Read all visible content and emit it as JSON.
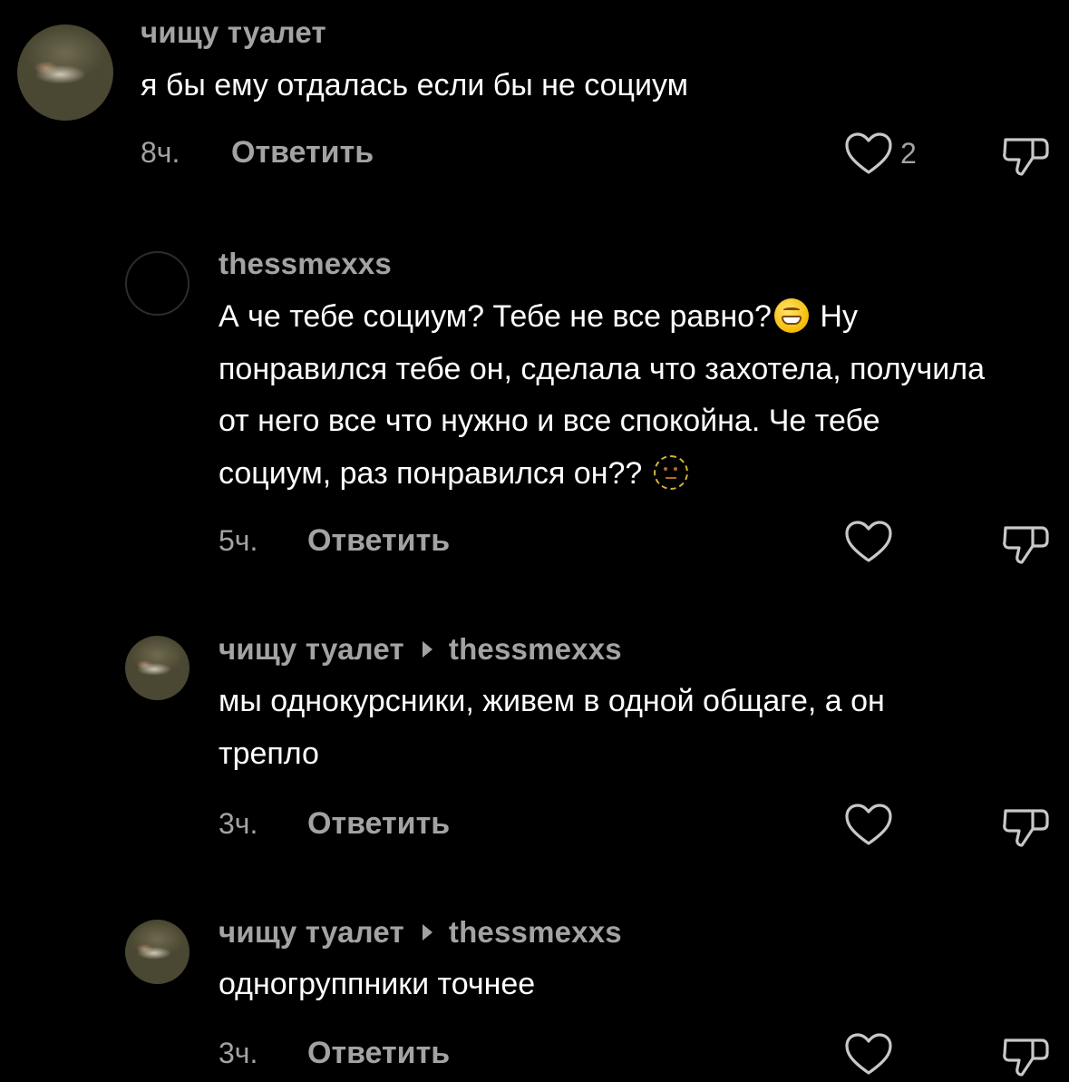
{
  "colors": {
    "background": "#000000",
    "primary_text": "#ffffff",
    "secondary_text": "#a3a3a3",
    "emoji_yellow": "#f5b800"
  },
  "comments": [
    {
      "username": "чищу туалет",
      "reply_to": "",
      "avatar": "painting-avatar",
      "lines": [
        "я бы ему отдалась если бы не социум"
      ],
      "time": "8ч.",
      "reply_label": "Ответить",
      "likes": "2",
      "like_icon": "heart-outline-icon",
      "dislike_icon": "thumbs-down-icon"
    },
    {
      "username": "thessmexxs",
      "reply_to": "",
      "avatar": "empty-avatar",
      "lines": [
        "А че тебе социум? Тебе не все равно?",
        " Ну",
        "понравился тебе он, сделала что захотела, получила",
        "от него все что нужно и все спокойна. Че тебе",
        "социум, раз понравился он?? "
      ],
      "emojis": [
        "grinning-face-emoji",
        "dotted-line-face-emoji"
      ],
      "time": "5ч.",
      "reply_label": "Ответить",
      "likes": "",
      "like_icon": "heart-outline-icon",
      "dislike_icon": "thumbs-down-icon"
    },
    {
      "username": "чищу туалет",
      "reply_to": "thessmexxs",
      "avatar": "painting-avatar",
      "lines": [
        "мы однокурсники, живем в одной общаге, а он",
        "трепло"
      ],
      "time": "3ч.",
      "reply_label": "Ответить",
      "likes": "",
      "like_icon": "heart-outline-icon",
      "dislike_icon": "thumbs-down-icon"
    },
    {
      "username": "чищу туалет",
      "reply_to": "thessmexxs",
      "avatar": "painting-avatar",
      "lines": [
        "одногруппники точнее"
      ],
      "time": "3ч.",
      "reply_label": "Ответить",
      "likes": "",
      "like_icon": "heart-outline-icon",
      "dislike_icon": "thumbs-down-icon"
    }
  ]
}
